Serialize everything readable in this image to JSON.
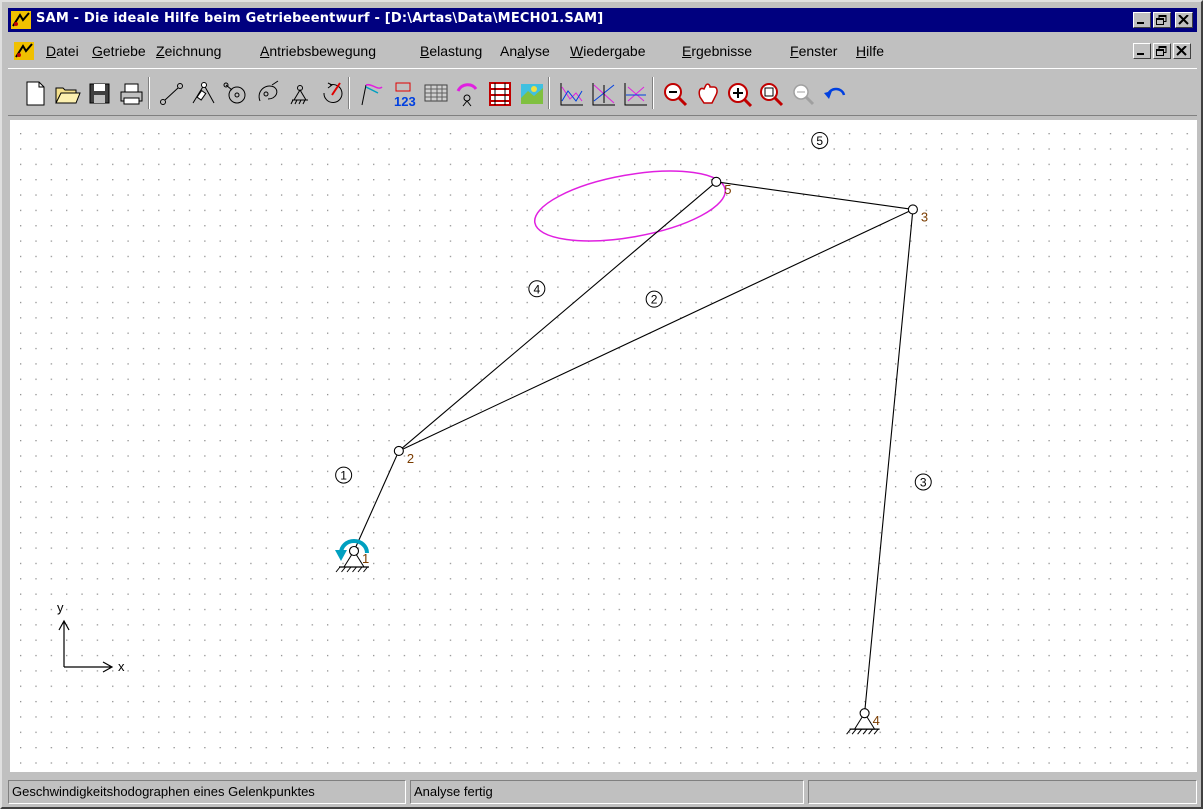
{
  "window": {
    "title": "SAM - Die ideale Hilfe beim Getriebeentwurf - [D:\\Artas\\Data\\MECH01.SAM]",
    "caption_buttons": [
      "_",
      "□",
      "×"
    ]
  },
  "menu": {
    "items": [
      {
        "accel": "D",
        "rest": "atei"
      },
      {
        "accel": "G",
        "rest": "etriebe"
      },
      {
        "accel": "Z",
        "rest": "eichnung"
      },
      {
        "accel": "A",
        "rest": "ntriebsbewegung"
      },
      {
        "accel": "B",
        "rest": "elastung"
      },
      {
        "pre": "An",
        "accel": "a",
        "rest": "lyse"
      },
      {
        "accel": "W",
        "rest": "iedergabe"
      },
      {
        "accel": "E",
        "rest": "rgebnisse"
      },
      {
        "accel": "F",
        "rest": "enster"
      },
      {
        "accel": "H",
        "rest": "ilfe"
      }
    ]
  },
  "toolbar": {
    "icons": [
      "new-file-icon",
      "open-folder-icon",
      "save-disk-icon",
      "print-icon",
      "beam-element-icon",
      "slider-element-icon",
      "gear-element-icon",
      "cam-element-icon",
      "ground-support-icon",
      "drive-motor-icon",
      "path-tracing-icon",
      "numbering-icon",
      "table-icon",
      "angle-motion-icon",
      "film-frames-icon",
      "colored-scene-icon",
      "chart-xy-icon",
      "chart-xy-second-icon",
      "chart-xy-third-icon",
      "zoom-out-icon",
      "pan-hand-icon",
      "zoom-in-icon",
      "zoom-window-icon",
      "zoom-all-icon",
      "undo-icon"
    ]
  },
  "mechanism": {
    "nodes": [
      {
        "label": "1",
        "x": 0.0,
        "y": 0.0
      },
      {
        "label": "2",
        "x": 1.3,
        "y": 2.9
      },
      {
        "label": "3",
        "x": 16.2,
        "y": 9.9
      },
      {
        "label": "4",
        "x": 14.8,
        "y": -4.7
      },
      {
        "label": "5",
        "x": 10.5,
        "y": 10.7
      }
    ],
    "links": [
      {
        "label": "1",
        "from": 0,
        "to": 1
      },
      {
        "label": "2",
        "from": 1,
        "to": 2
      },
      {
        "label": "3",
        "from": 2,
        "to": 3
      },
      {
        "label": "4",
        "from": 1,
        "to": 4
      },
      {
        "label": "5",
        "from": 4,
        "to": 2
      }
    ],
    "link_label_anchors": [
      {
        "label": "1",
        "x": -0.3,
        "y": 2.2
      },
      {
        "label": "2",
        "x": 8.7,
        "y": 7.3
      },
      {
        "label": "3",
        "x": 16.5,
        "y": 2.0
      },
      {
        "label": "4",
        "x": 5.3,
        "y": 7.6
      },
      {
        "label": "5",
        "x": 13.5,
        "y": 11.9
      }
    ],
    "hodograph": {
      "cx": 8.0,
      "cy": 10.0,
      "rx": 2.8,
      "ry": 0.9,
      "tilt_deg": 10
    },
    "drive_node": "1",
    "ground_nodes": [
      "1",
      "4"
    ],
    "colors": {
      "link": "#000000",
      "node_label": "#7a3c00",
      "hodograph": "#e020e0",
      "drive": "#00a0c0"
    }
  },
  "axes": {
    "x_label": "x",
    "y_label": "y"
  },
  "status": {
    "message": "Geschwindigkeitshodographen eines Gelenkpunktes",
    "state": "Analyse fertig",
    "extra": ""
  }
}
